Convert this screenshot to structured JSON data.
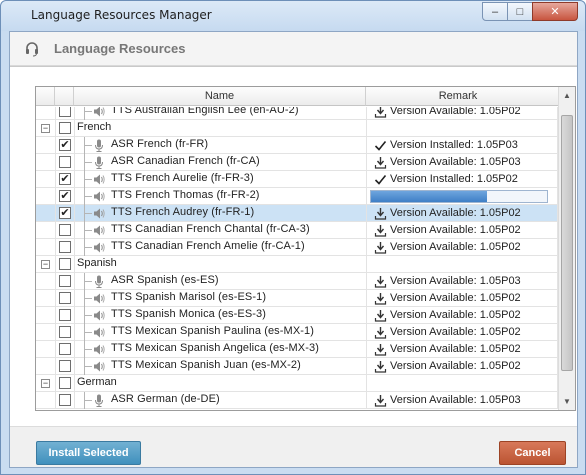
{
  "window": {
    "title": "Language Resources Manager",
    "controls": {
      "minimize": "–",
      "maximize": "□",
      "close": "✕"
    }
  },
  "header": {
    "title": "Language Resources",
    "icon": "headset-icon"
  },
  "table": {
    "columns": {
      "name": "Name",
      "remark": "Remark"
    },
    "rows": [
      {
        "kind": "item",
        "icon": "speaker-icon",
        "label": "TTS Australian English Lee (en-AU-2)",
        "checked": false,
        "remark_icon": "download-icon",
        "remark": "Version Available: 1.05P02",
        "partial": true
      },
      {
        "kind": "group",
        "label": "French",
        "checked": false
      },
      {
        "kind": "item",
        "icon": "microphone-icon",
        "label": "ASR French (fr-FR)",
        "checked": true,
        "remark_icon": "check-icon",
        "remark": "Version Installed: 1.05P03"
      },
      {
        "kind": "item",
        "icon": "microphone-icon",
        "label": "ASR Canadian French (fr-CA)",
        "checked": false,
        "remark_icon": "download-icon",
        "remark": "Version Available: 1.05P03"
      },
      {
        "kind": "item",
        "icon": "speaker-icon",
        "label": "TTS French Aurelie (fr-FR-3)",
        "checked": true,
        "remark_icon": "check-icon",
        "remark": "Version Installed: 1.05P02"
      },
      {
        "kind": "item",
        "icon": "speaker-icon",
        "label": "TTS French Thomas (fr-FR-2)",
        "checked": true,
        "progress": 0.66
      },
      {
        "kind": "item",
        "icon": "speaker-icon",
        "label": "TTS French Audrey (fr-FR-1)",
        "checked": true,
        "remark_icon": "download-icon",
        "remark": "Version Available: 1.05P02",
        "selected": true
      },
      {
        "kind": "item",
        "icon": "speaker-icon",
        "label": "TTS Canadian French Chantal (fr-CA-3)",
        "checked": false,
        "remark_icon": "download-icon",
        "remark": "Version Available: 1.05P02"
      },
      {
        "kind": "item",
        "icon": "speaker-icon",
        "label": "TTS Canadian French Amelie (fr-CA-1)",
        "checked": false,
        "remark_icon": "download-icon",
        "remark": "Version Available: 1.05P02"
      },
      {
        "kind": "group",
        "label": "Spanish",
        "checked": false
      },
      {
        "kind": "item",
        "icon": "microphone-icon",
        "label": "ASR Spanish (es-ES)",
        "checked": false,
        "remark_icon": "download-icon",
        "remark": "Version Available: 1.05P03"
      },
      {
        "kind": "item",
        "icon": "speaker-icon",
        "label": "TTS Spanish Marisol (es-ES-1)",
        "checked": false,
        "remark_icon": "download-icon",
        "remark": "Version Available: 1.05P02"
      },
      {
        "kind": "item",
        "icon": "speaker-icon",
        "label": "TTS Spanish Monica (es-ES-3)",
        "checked": false,
        "remark_icon": "download-icon",
        "remark": "Version Available: 1.05P02"
      },
      {
        "kind": "item",
        "icon": "speaker-icon",
        "label": "TTS Mexican Spanish Paulina (es-MX-1)",
        "checked": false,
        "remark_icon": "download-icon",
        "remark": "Version Available: 1.05P02"
      },
      {
        "kind": "item",
        "icon": "speaker-icon",
        "label": "TTS Mexican Spanish Angelica (es-MX-3)",
        "checked": false,
        "remark_icon": "download-icon",
        "remark": "Version Available: 1.05P02"
      },
      {
        "kind": "item",
        "icon": "speaker-icon",
        "label": "TTS Mexican Spanish Juan (es-MX-2)",
        "checked": false,
        "remark_icon": "download-icon",
        "remark": "Version Available: 1.05P02"
      },
      {
        "kind": "group",
        "label": "German",
        "checked": false
      },
      {
        "kind": "item",
        "icon": "microphone-icon",
        "label": "ASR German (de-DE)",
        "checked": false,
        "remark_icon": "download-icon",
        "remark": "Version Available: 1.05P03"
      }
    ]
  },
  "footer": {
    "install_label": "Install Selected",
    "cancel_label": "Cancel"
  },
  "colors": {
    "install": "#4a9ac5",
    "cancel": "#c75f3c",
    "selection": "#cce2f5",
    "progress": "#3f7fc6"
  }
}
